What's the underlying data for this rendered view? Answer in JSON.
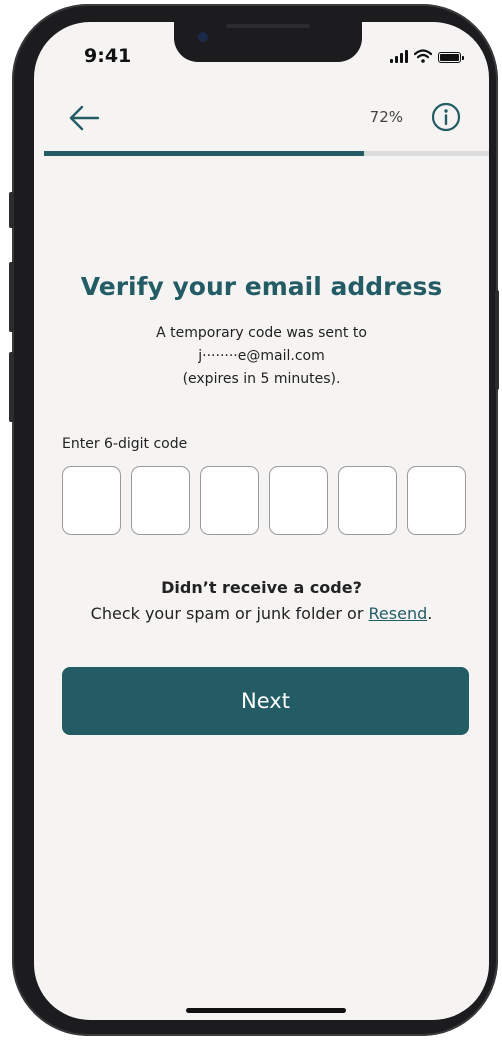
{
  "status_bar": {
    "time": "9:41",
    "icons": [
      "signal-icon",
      "wifi-icon",
      "battery-icon"
    ]
  },
  "header": {
    "back_icon": "arrow-left-icon",
    "progress_label": "72%",
    "progress_value": 0.72,
    "info_icon": "info-circle-icon"
  },
  "main": {
    "title": "Verify your email address",
    "subtitle_line1": "A temporary code was sent to",
    "subtitle_line2": "j········e@mail.com",
    "subtitle_line3": "(expires in 5 minutes).",
    "code_label": "Enter 6-digit code",
    "code_digits": [
      "",
      "",
      "",
      "",
      "",
      ""
    ],
    "help_title": "Didn’t receive a code?",
    "help_prefix": "Check your spam or junk folder or ",
    "help_link": "Resend",
    "help_suffix": ".",
    "next_label": "Next"
  },
  "colors": {
    "accent": "#245c66",
    "background": "#f5f4f2",
    "progress_track": "#dcdcdc"
  }
}
